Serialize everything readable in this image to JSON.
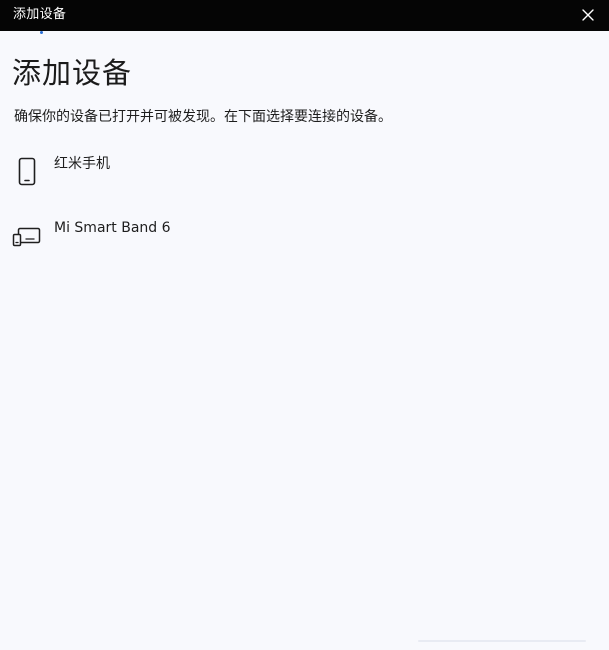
{
  "window": {
    "title": "添加设备",
    "close_icon": "close-icon"
  },
  "main": {
    "heading": "添加设备",
    "instructions": "确保你的设备已打开并可被发现。在下面选择要连接的设备。",
    "devices": [
      {
        "label": "红米手机",
        "icon": "phone-icon"
      },
      {
        "label": "Mi Smart Band 6",
        "icon": "wearable-device-icon"
      }
    ]
  },
  "colors": {
    "titlebar": "#050505",
    "background": "#f8f9fd",
    "accent": "#2b6fd6"
  }
}
